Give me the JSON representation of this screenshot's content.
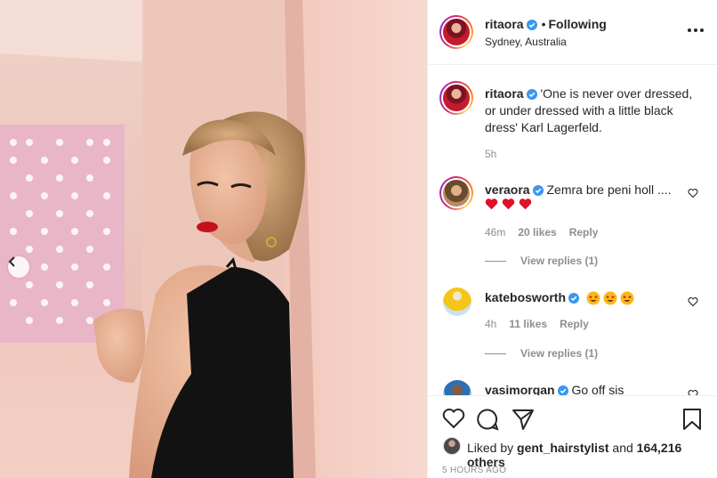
{
  "header": {
    "username": "ritaora",
    "separator": "•",
    "follow_status": "Following",
    "location": "Sydney, Australia"
  },
  "caption": {
    "username": "ritaora",
    "text": "'One is never over dressed, or under dressed with a little black dress' Karl Lagerfeld.",
    "age": "5h"
  },
  "comments": [
    {
      "username": "veraora",
      "text": "Zemra bre peni holl ....",
      "age": "46m",
      "likes": "20 likes",
      "reply": "Reply",
      "view_replies": "View replies (1)"
    },
    {
      "username": "katebosworth",
      "text": "",
      "age": "4h",
      "likes": "11 likes",
      "reply": "Reply",
      "view_replies": "View replies (1)"
    },
    {
      "username": "vasimorgan",
      "text": "Go off sis"
    }
  ],
  "likes": {
    "prefix": "Liked by",
    "user": "gent_hairstylist",
    "conj": "and",
    "others": "164,216 others"
  },
  "timestamp": "5 hours ago",
  "colors": {
    "verified": "#3897f0",
    "heart_red": "#ed4956",
    "text": "#262626",
    "muted": "#8e8e8e"
  }
}
